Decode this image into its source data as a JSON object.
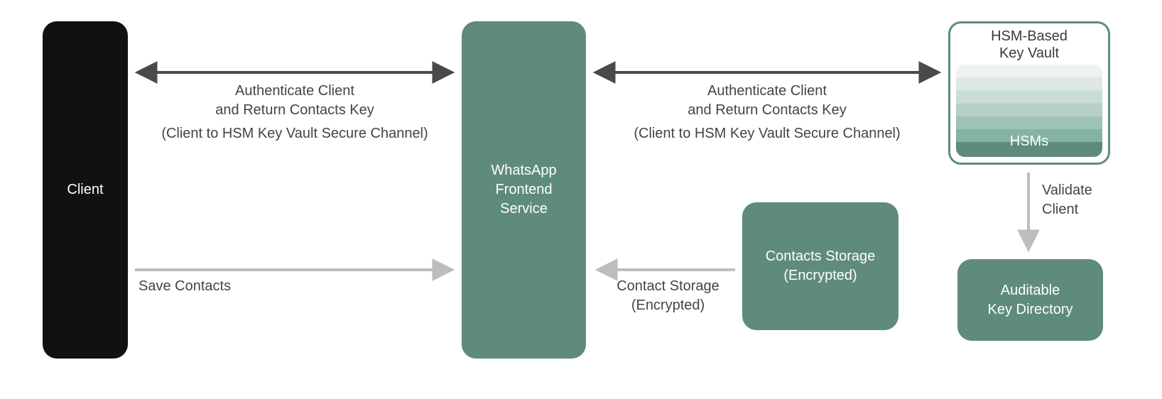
{
  "nodes": {
    "client": "Client",
    "frontend": "WhatsApp\nFrontend\nService",
    "storage": "Contacts Storage\n(Encrypted)",
    "directory": "Auditable\nKey Directory",
    "vault_title": "HSM-Based\nKey Vault",
    "vault_body": "HSMs"
  },
  "edges": {
    "auth_left": {
      "line1": "Authenticate Client",
      "line2": "and Return Contacts Key",
      "line3": "(Client to HSM Key Vault Secure Channel)"
    },
    "auth_right": {
      "line1": "Authenticate Client",
      "line2": "and Return Contacts Key",
      "line3": "(Client to HSM Key Vault Secure Channel)"
    },
    "save_contacts": "Save Contacts",
    "contact_storage": {
      "line1": "Contact Storage",
      "line2": "(Encrypted)"
    },
    "validate_client": {
      "line1": "Validate",
      "line2": "Client"
    }
  }
}
